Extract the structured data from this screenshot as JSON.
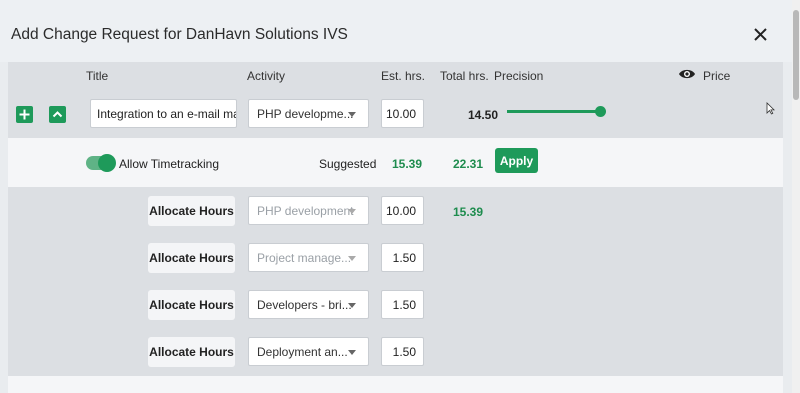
{
  "dialog": {
    "title": "Add Change Request for DanHavn Solutions IVS"
  },
  "columns": {
    "title": "Title",
    "activity": "Activity",
    "est_hrs": "Est. hrs.",
    "total_hrs": "Total hrs.",
    "precision": "Precision",
    "price": "Price"
  },
  "task": {
    "title_value": "Integration to an e-mail marketi",
    "activity": "PHP developme...",
    "est_hrs": "10.00",
    "total_hrs": "14.50",
    "precision_level": 1.0
  },
  "suggestion": {
    "toggle_label": "Allow Timetracking",
    "toggle_on": true,
    "suggested_label": "Suggested",
    "suggested_est": "15.39",
    "suggested_total": "22.31",
    "apply_label": "Apply"
  },
  "allocations": [
    {
      "button": "Allocate Hours",
      "activity": "PHP development",
      "hours": "10.00",
      "suggested": "15.39",
      "disabled": true
    },
    {
      "button": "Allocate Hours",
      "activity": "Project manage...",
      "hours": "1.50",
      "suggested": "",
      "disabled": true
    },
    {
      "button": "Allocate Hours",
      "activity": "Developers - bri...",
      "hours": "1.50",
      "suggested": "",
      "disabled": false
    },
    {
      "button": "Allocate Hours",
      "activity": "Deployment an...",
      "hours": "1.50",
      "suggested": "",
      "disabled": false
    }
  ],
  "colors": {
    "accent": "#1e9a5a",
    "suggested_text": "#1e8c4e"
  },
  "icons": {
    "close": "close-icon",
    "add": "plus-icon",
    "collapse": "chevron-up-icon",
    "price_visibility": "eye-icon",
    "dropdown": "caret-down-icon"
  }
}
